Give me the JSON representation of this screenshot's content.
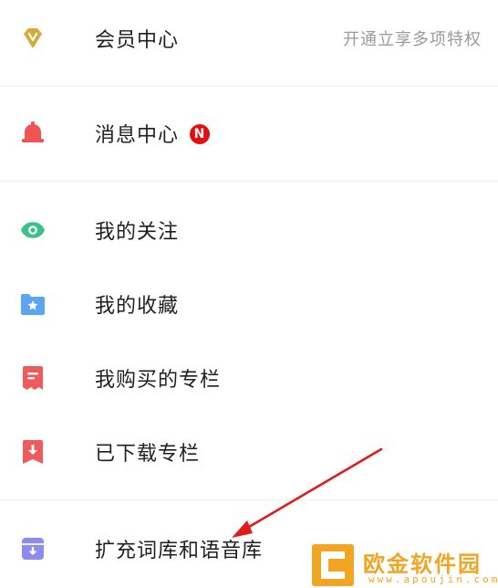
{
  "menu": {
    "vip": {
      "label": "会员中心",
      "right_text": "开通立享多项特权",
      "icon": "diamond-v-icon",
      "color": "#d9a93a"
    },
    "messages": {
      "label": "消息中心",
      "badge": "N",
      "icon": "bell-icon",
      "color": "#f05454",
      "badge_color": "#e30e0e"
    },
    "following": {
      "label": "我的关注",
      "icon": "eye-icon",
      "color": "#3ec08c"
    },
    "favorites": {
      "label": "我的收藏",
      "icon": "star-folder-icon",
      "color": "#5aa6f2"
    },
    "purchased": {
      "label": "我购买的专栏",
      "icon": "receipt-icon",
      "color": "#ef5b5b"
    },
    "downloaded": {
      "label": "已下载专栏",
      "icon": "download-bookmark-icon",
      "color": "#ef5b5b"
    },
    "dictionary": {
      "label": "扩充词库和语音库",
      "icon": "archive-download-icon",
      "color": "#8c8cf0"
    }
  },
  "watermark": {
    "main": "欧金软件园",
    "sub": "www.apoujin.com",
    "color": "#f0a623"
  },
  "annotation": {
    "arrow_color": "#e01b1b"
  }
}
